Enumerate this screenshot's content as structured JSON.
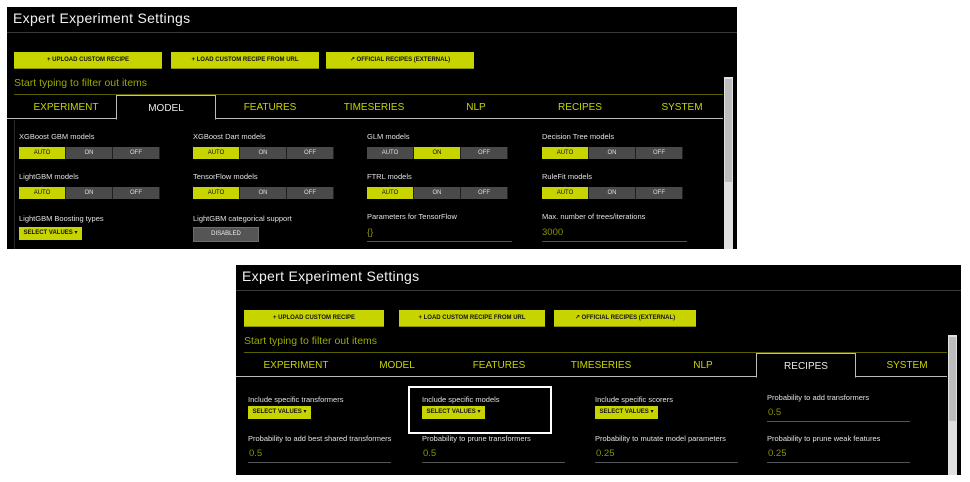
{
  "panel_a": {
    "title": "Expert Experiment Settings",
    "buttons": {
      "upload": "+ UPLOAD CUSTOM RECIPE",
      "load_url": "+ LOAD CUSTOM RECIPE FROM URL",
      "official": "↗ OFFICIAL RECIPES (EXTERNAL)"
    },
    "filter_placeholder": "Start typing to filter out items",
    "tabs": [
      "EXPERIMENT",
      "MODEL",
      "FEATURES",
      "TIMESERIES",
      "NLP",
      "RECIPES",
      "SYSTEM"
    ],
    "active_tab": "MODEL",
    "toggle_options": [
      "AUTO",
      "ON",
      "OFF"
    ],
    "toggles": [
      {
        "label": "XGBoost GBM models",
        "selected": "AUTO"
      },
      {
        "label": "XGBoost Dart models",
        "selected": "AUTO"
      },
      {
        "label": "GLM models",
        "selected": "ON"
      },
      {
        "label": "Decision Tree models",
        "selected": "AUTO"
      },
      {
        "label": "LightGBM models",
        "selected": "AUTO"
      },
      {
        "label": "TensorFlow models",
        "selected": "AUTO"
      },
      {
        "label": "FTRL models",
        "selected": "AUTO"
      },
      {
        "label": "RuleFit models",
        "selected": "AUTO"
      }
    ],
    "boosting_types": {
      "label": "LightGBM Boosting types",
      "button": "SELECT VALUES ▾"
    },
    "categorical": {
      "label": "LightGBM categorical support",
      "button": "DISABLED"
    },
    "tf_params": {
      "label": "Parameters for TensorFlow",
      "value": "{}"
    },
    "max_trees": {
      "label": "Max. number of trees/iterations",
      "value": "3000"
    }
  },
  "panel_b": {
    "title": "Expert Experiment Settings",
    "buttons": {
      "upload": "+ UPLOAD CUSTOM RECIPE",
      "load_url": "+ LOAD CUSTOM RECIPE FROM URL",
      "official": "↗ OFFICIAL RECIPES (EXTERNAL)"
    },
    "filter_placeholder": "Start typing to filter out items",
    "tabs": [
      "EXPERIMENT",
      "MODEL",
      "FEATURES",
      "TIMESERIES",
      "NLP",
      "RECIPES",
      "SYSTEM"
    ],
    "active_tab": "RECIPES",
    "select_fields": [
      {
        "label": "Include specific transformers",
        "button": "SELECT VALUES ▾"
      },
      {
        "label": "Include specific models",
        "button": "SELECT VALUES ▾"
      },
      {
        "label": "Include specific scorers",
        "button": "SELECT VALUES ▾"
      }
    ],
    "prob_fields": [
      {
        "label": "Probability to add transformers",
        "value": "0.5"
      },
      {
        "label": "Probability to add best shared transformers",
        "value": "0.5"
      },
      {
        "label": "Probability to prune transformers",
        "value": "0.5"
      },
      {
        "label": "Probability to mutate model parameters",
        "value": "0.25"
      },
      {
        "label": "Probability to prune weak features",
        "value": "0.25"
      }
    ]
  }
}
